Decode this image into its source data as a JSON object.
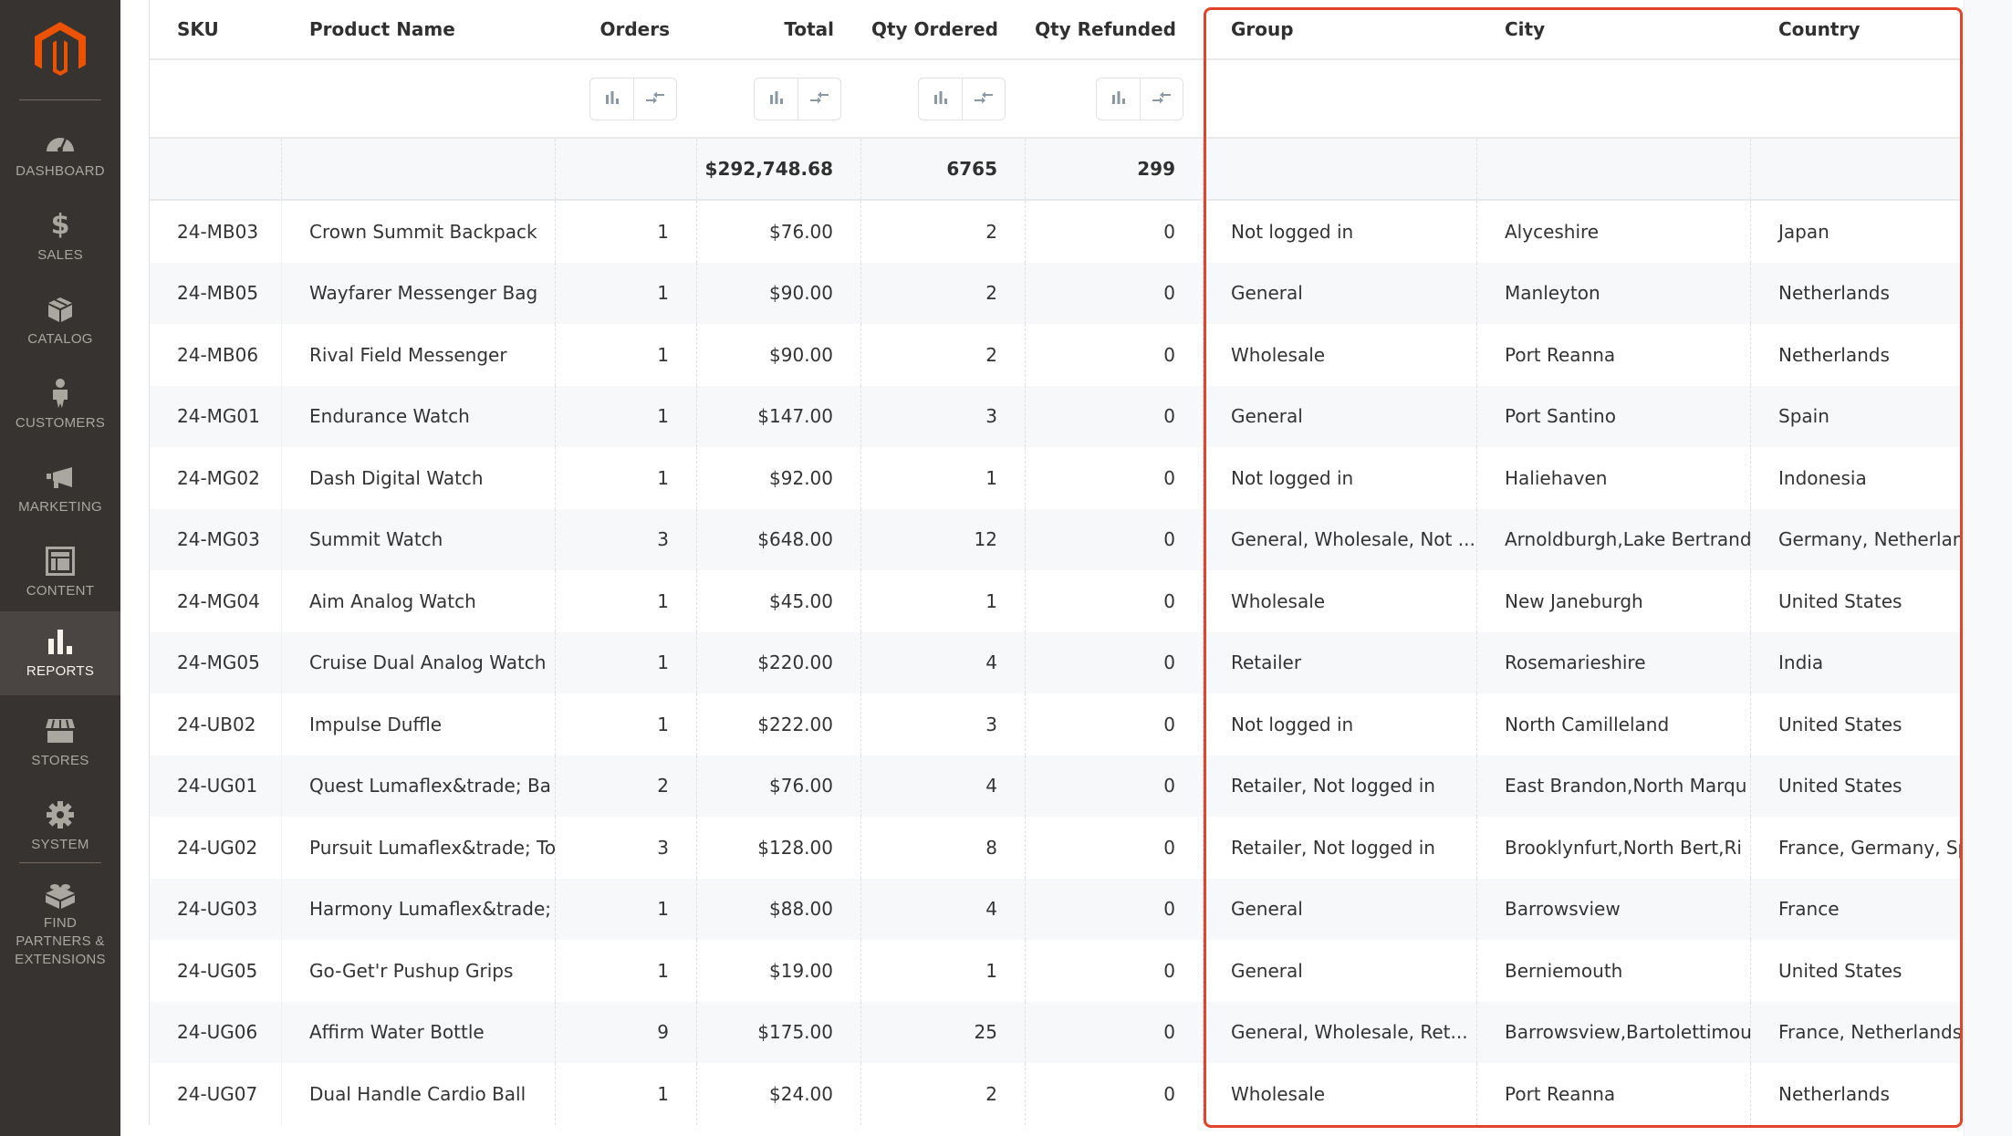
{
  "sidebar": {
    "logo": "magento-logo",
    "items": [
      {
        "label": "DASHBOARD",
        "icon": "dashboard-gauge-icon",
        "active": false
      },
      {
        "label": "SALES",
        "icon": "dollar-icon",
        "active": false
      },
      {
        "label": "CATALOG",
        "icon": "box-icon",
        "active": false
      },
      {
        "label": "CUSTOMERS",
        "icon": "person-icon",
        "active": false
      },
      {
        "label": "MARKETING",
        "icon": "megaphone-icon",
        "active": false
      },
      {
        "label": "CONTENT",
        "icon": "layout-icon",
        "active": false
      },
      {
        "label": "REPORTS",
        "icon": "bar-chart-icon",
        "active": true
      },
      {
        "label": "STORES",
        "icon": "storefront-icon",
        "active": false
      },
      {
        "label": "SYSTEM",
        "icon": "gear-icon",
        "active": false
      },
      {
        "label": "FIND PARTNERS & EXTENSIONS",
        "icon": "lego-block-icon",
        "active": false
      }
    ]
  },
  "table": {
    "columns": [
      {
        "key": "sku",
        "label": "SKU"
      },
      {
        "key": "name",
        "label": "Product Name"
      },
      {
        "key": "orders",
        "label": "Orders"
      },
      {
        "key": "total",
        "label": "Total"
      },
      {
        "key": "qty_ordered",
        "label": "Qty Ordered"
      },
      {
        "key": "qty_refunded",
        "label": "Qty Refunded"
      },
      {
        "key": "group",
        "label": "Group"
      },
      {
        "key": "city",
        "label": "City"
      },
      {
        "key": "country",
        "label": "Country"
      }
    ],
    "column_tools": {
      "chart_button": "bar-chart-icon",
      "compare_button": "compare-arrows-icon"
    },
    "totals": {
      "total": "$292,748.68",
      "qty_ordered": "6765",
      "qty_refunded": "299"
    },
    "rows": [
      {
        "sku": "24-MB03",
        "name": "Crown Summit Backpack",
        "orders": "1",
        "total": "$76.00",
        "qty_ordered": "2",
        "qty_refunded": "0",
        "group": "Not logged in",
        "city": "Alyceshire",
        "country": "Japan"
      },
      {
        "sku": "24-MB05",
        "name": "Wayfarer Messenger Bag",
        "orders": "1",
        "total": "$90.00",
        "qty_ordered": "2",
        "qty_refunded": "0",
        "group": "General",
        "city": "Manleyton",
        "country": "Netherlands"
      },
      {
        "sku": "24-MB06",
        "name": "Rival Field Messenger",
        "orders": "1",
        "total": "$90.00",
        "qty_ordered": "2",
        "qty_refunded": "0",
        "group": "Wholesale",
        "city": "Port Reanna",
        "country": "Netherlands"
      },
      {
        "sku": "24-MG01",
        "name": "Endurance Watch",
        "orders": "1",
        "total": "$147.00",
        "qty_ordered": "3",
        "qty_refunded": "0",
        "group": "General",
        "city": "Port Santino",
        "country": "Spain"
      },
      {
        "sku": "24-MG02",
        "name": "Dash Digital Watch",
        "orders": "1",
        "total": "$92.00",
        "qty_ordered": "1",
        "qty_refunded": "0",
        "group": "Not logged in",
        "city": "Haliehaven",
        "country": "Indonesia"
      },
      {
        "sku": "24-MG03",
        "name": "Summit Watch",
        "orders": "3",
        "total": "$648.00",
        "qty_ordered": "12",
        "qty_refunded": "0",
        "group": "General, Wholesale, Not ...",
        "city": "Arnoldburgh,Lake Bertrand",
        "country": "Germany, Netherland"
      },
      {
        "sku": "24-MG04",
        "name": "Aim Analog Watch",
        "orders": "1",
        "total": "$45.00",
        "qty_ordered": "1",
        "qty_refunded": "0",
        "group": "Wholesale",
        "city": "New Janeburgh",
        "country": "United States"
      },
      {
        "sku": "24-MG05",
        "name": "Cruise Dual Analog Watch",
        "orders": "1",
        "total": "$220.00",
        "qty_ordered": "4",
        "qty_refunded": "0",
        "group": "Retailer",
        "city": "Rosemarieshire",
        "country": "India"
      },
      {
        "sku": "24-UB02",
        "name": "Impulse Duffle",
        "orders": "1",
        "total": "$222.00",
        "qty_ordered": "3",
        "qty_refunded": "0",
        "group": "Not logged in",
        "city": "North Camilleland",
        "country": "United States"
      },
      {
        "sku": "24-UG01",
        "name": "Quest Lumaflex&trade; Ba",
        "orders": "2",
        "total": "$76.00",
        "qty_ordered": "4",
        "qty_refunded": "0",
        "group": "Retailer, Not logged in",
        "city": "East Brandon,North Marqu",
        "country": "United States"
      },
      {
        "sku": "24-UG02",
        "name": "Pursuit Lumaflex&trade; To",
        "orders": "3",
        "total": "$128.00",
        "qty_ordered": "8",
        "qty_refunded": "0",
        "group": "Retailer, Not logged in",
        "city": "Brooklynfurt,North Bert,Ri",
        "country": "France, Germany, Spa"
      },
      {
        "sku": "24-UG03",
        "name": "Harmony Lumaflex&trade;",
        "orders": "1",
        "total": "$88.00",
        "qty_ordered": "4",
        "qty_refunded": "0",
        "group": "General",
        "city": "Barrowsview",
        "country": "France"
      },
      {
        "sku": "24-UG05",
        "name": "Go-Get'r Pushup Grips",
        "orders": "1",
        "total": "$19.00",
        "qty_ordered": "1",
        "qty_refunded": "0",
        "group": "General",
        "city": "Berniemouth",
        "country": "United States"
      },
      {
        "sku": "24-UG06",
        "name": "Affirm Water Bottle",
        "orders": "9",
        "total": "$175.00",
        "qty_ordered": "25",
        "qty_refunded": "0",
        "group": "General, Wholesale, Ret...",
        "city": "Barrowsview,Bartolettimou",
        "country": "France, Netherlands,"
      },
      {
        "sku": "24-UG07",
        "name": "Dual Handle Cardio Ball",
        "orders": "1",
        "total": "$24.00",
        "qty_ordered": "2",
        "qty_refunded": "0",
        "group": "Wholesale",
        "city": "Port Reanna",
        "country": "Netherlands"
      }
    ]
  },
  "highlight": {
    "color": "#e3432a",
    "columns": [
      "Group",
      "City",
      "Country"
    ]
  },
  "colors": {
    "sidebar_bg": "#373330",
    "sidebar_active_bg": "#4a4542",
    "brand_orange": "#eb5202",
    "icon_gray": "#8a97a5"
  }
}
